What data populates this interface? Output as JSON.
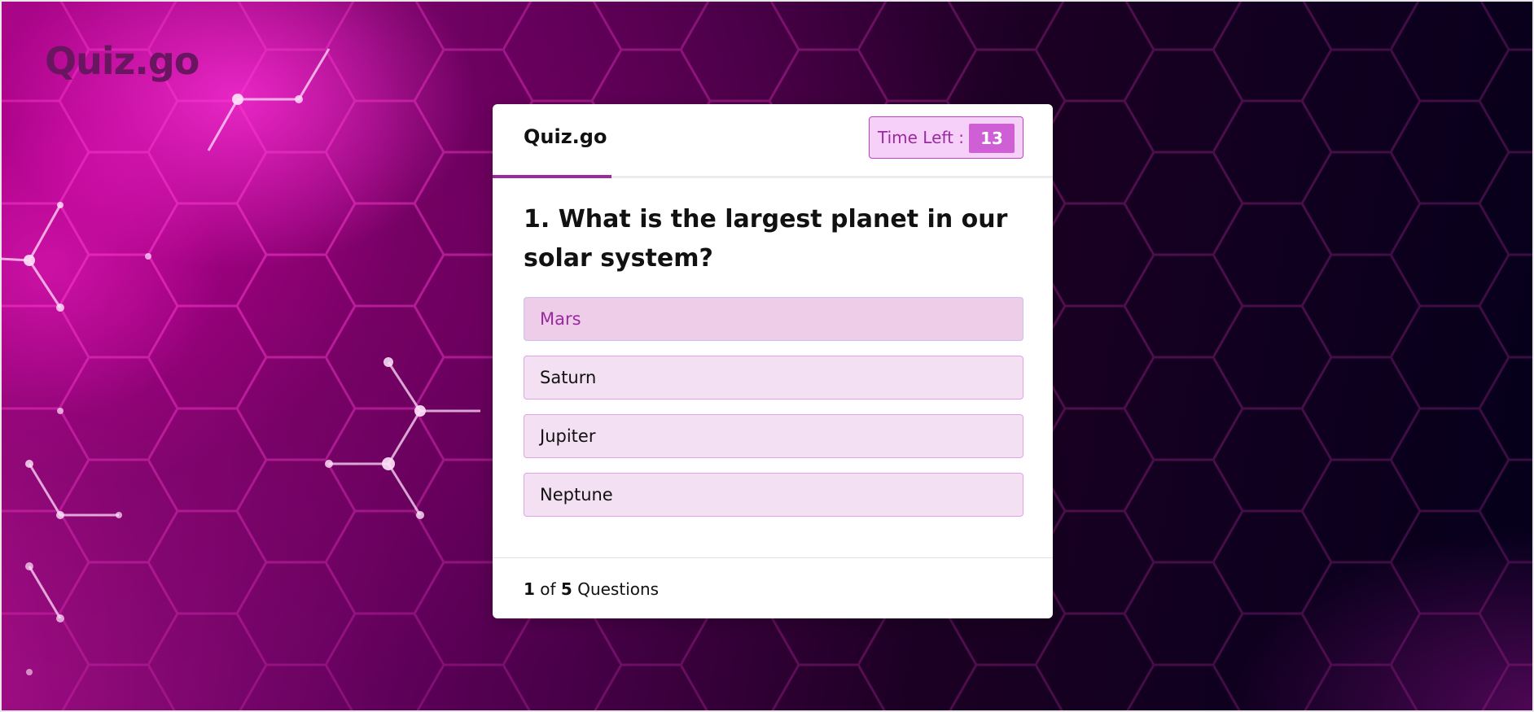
{
  "brand": {
    "logo_text": "Quiz.go"
  },
  "quiz_card": {
    "title": "Quiz.go",
    "timer": {
      "label": "Time Left :",
      "value": "13"
    },
    "question": {
      "text": "1. What is the largest planet in our solar system?"
    },
    "options": [
      {
        "label": "Mars",
        "selected": true
      },
      {
        "label": "Saturn",
        "selected": false
      },
      {
        "label": "Jupiter",
        "selected": false
      },
      {
        "label": "Neptune",
        "selected": false
      }
    ],
    "footer": {
      "current": "1",
      "of_text": "of",
      "total": "5",
      "suffix": "Questions"
    }
  },
  "colors": {
    "accent": "#9a2a9e",
    "timer_bg": "#f6d0f8",
    "timer_value_bg": "#cf5fd4",
    "option_bg": "#f3e1f3",
    "option_selected_bg": "#eecde9",
    "brand_text": "#6a1560"
  }
}
